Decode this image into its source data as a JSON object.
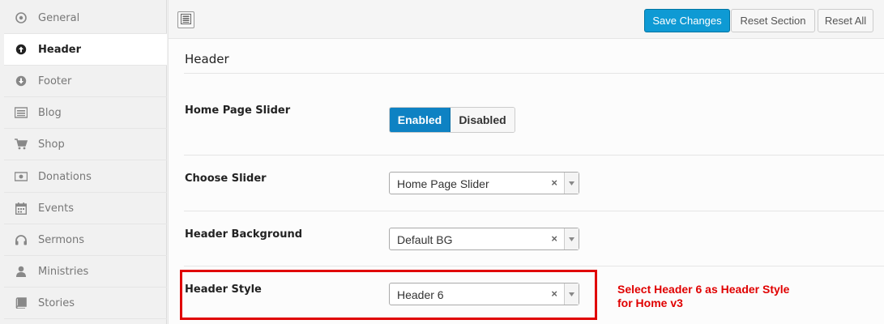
{
  "sidebar": {
    "items": [
      {
        "label": "General",
        "icon": "target-icon"
      },
      {
        "label": "Header",
        "icon": "arrow-up-circle-icon"
      },
      {
        "label": "Footer",
        "icon": "arrow-down-circle-icon"
      },
      {
        "label": "Blog",
        "icon": "list-icon"
      },
      {
        "label": "Shop",
        "icon": "cart-icon"
      },
      {
        "label": "Donations",
        "icon": "money-icon"
      },
      {
        "label": "Events",
        "icon": "calendar-icon"
      },
      {
        "label": "Sermons",
        "icon": "headphones-icon"
      },
      {
        "label": "Ministries",
        "icon": "user-icon"
      },
      {
        "label": "Stories",
        "icon": "book-icon"
      }
    ],
    "active": "Header"
  },
  "toolbar": {
    "save_label": "Save Changes",
    "reset_section_label": "Reset Section",
    "reset_all_label": "Reset All"
  },
  "section": {
    "title": "Header",
    "home_slider": {
      "label": "Home Page Slider",
      "on_label": "Enabled",
      "off_label": "Disabled",
      "selected": "Enabled"
    },
    "choose_slider": {
      "label": "Choose Slider",
      "value": "Home Page Slider",
      "clear": "×"
    },
    "header_background": {
      "label": "Header Background",
      "value": "Default BG",
      "clear": "×"
    },
    "header_style": {
      "label": "Header Style",
      "value": "Header 6",
      "clear": "×"
    }
  },
  "annotation": {
    "line1": "Select Header 6 as Header Style",
    "line2": "for Home v3",
    "color": "#e00000"
  },
  "colors": {
    "primary": "#0e9ad4",
    "toggle_on": "#0e82c3"
  }
}
